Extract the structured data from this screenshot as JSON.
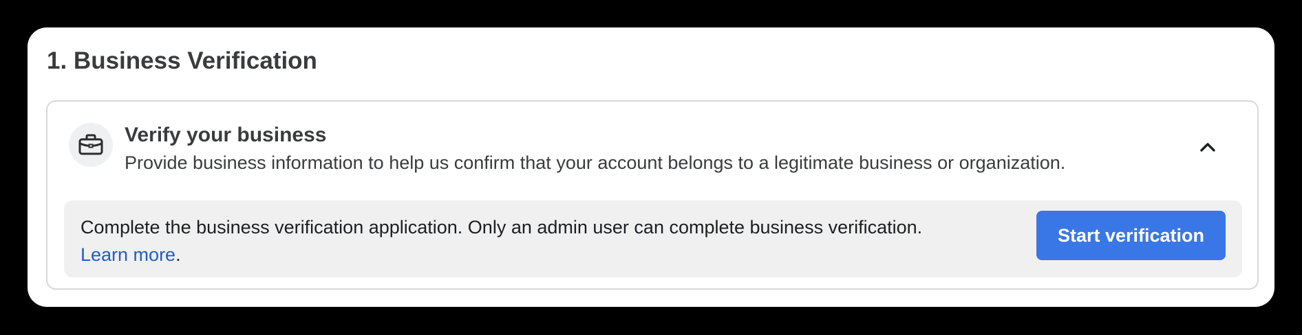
{
  "section": {
    "title": "1. Business Verification"
  },
  "card": {
    "icon": "briefcase-icon",
    "title": "Verify your business",
    "description": "Provide business information to help us confirm that your account belongs to a legitimate business or organization.",
    "toggle_icon": "chevron-up-icon"
  },
  "info": {
    "text": "Complete the business verification application. Only an admin user can complete business verification.",
    "link_label": "Learn more",
    "link_suffix": ".",
    "button_label": "Start verification"
  },
  "colors": {
    "page_background": "#000000",
    "panel_background": "#ffffff",
    "info_background": "#f0f0f0",
    "button": "#3a77e6",
    "link": "#1f5fbf"
  }
}
